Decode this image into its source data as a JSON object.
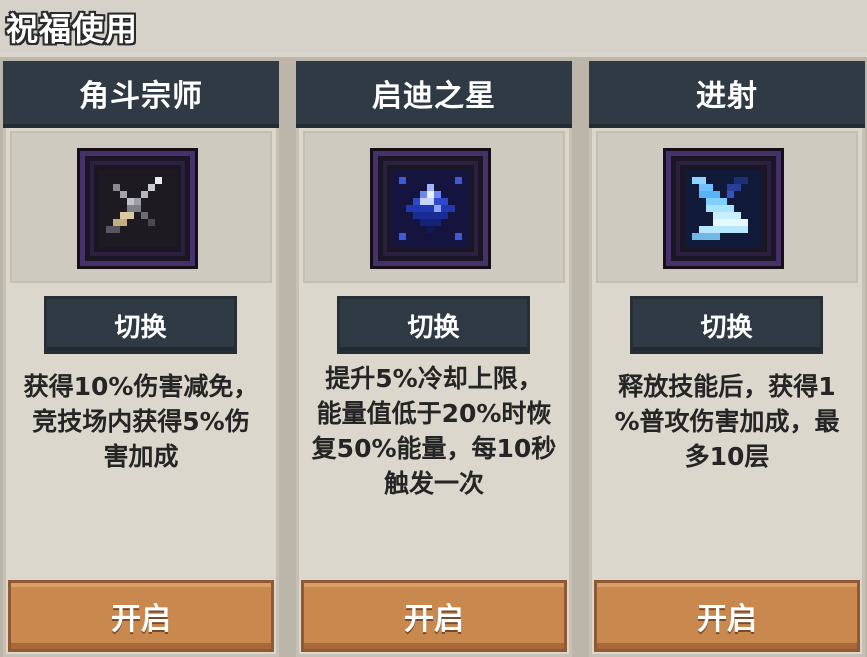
{
  "header": {
    "title": "祝福使用"
  },
  "cards": [
    {
      "title": "角斗宗师",
      "icon": "sword-icon",
      "switch_label": "切换",
      "description": "获得10%伤害减免，\n竞技场内获得5%伤\n害加成",
      "enable_label": "开启"
    },
    {
      "title": "启迪之星",
      "icon": "blue-star-gem-icon",
      "switch_label": "切换",
      "description": "提升5%冷却上限，\n能量值低于20%时恢\n复50%能量，每10秒\n触发一次",
      "enable_label": "开启"
    },
    {
      "title": "进射",
      "icon": "blue-bow-icon",
      "switch_label": "切换",
      "description": "释放技能后，获得1\n%普攻伤害加成，最\n多10层",
      "enable_label": "开启"
    }
  ],
  "colors": {
    "header_bar": "#2f3a45",
    "enable_button": "#c9894e",
    "card_bg": "#dcd7cd",
    "icon_border": "#46316a"
  }
}
